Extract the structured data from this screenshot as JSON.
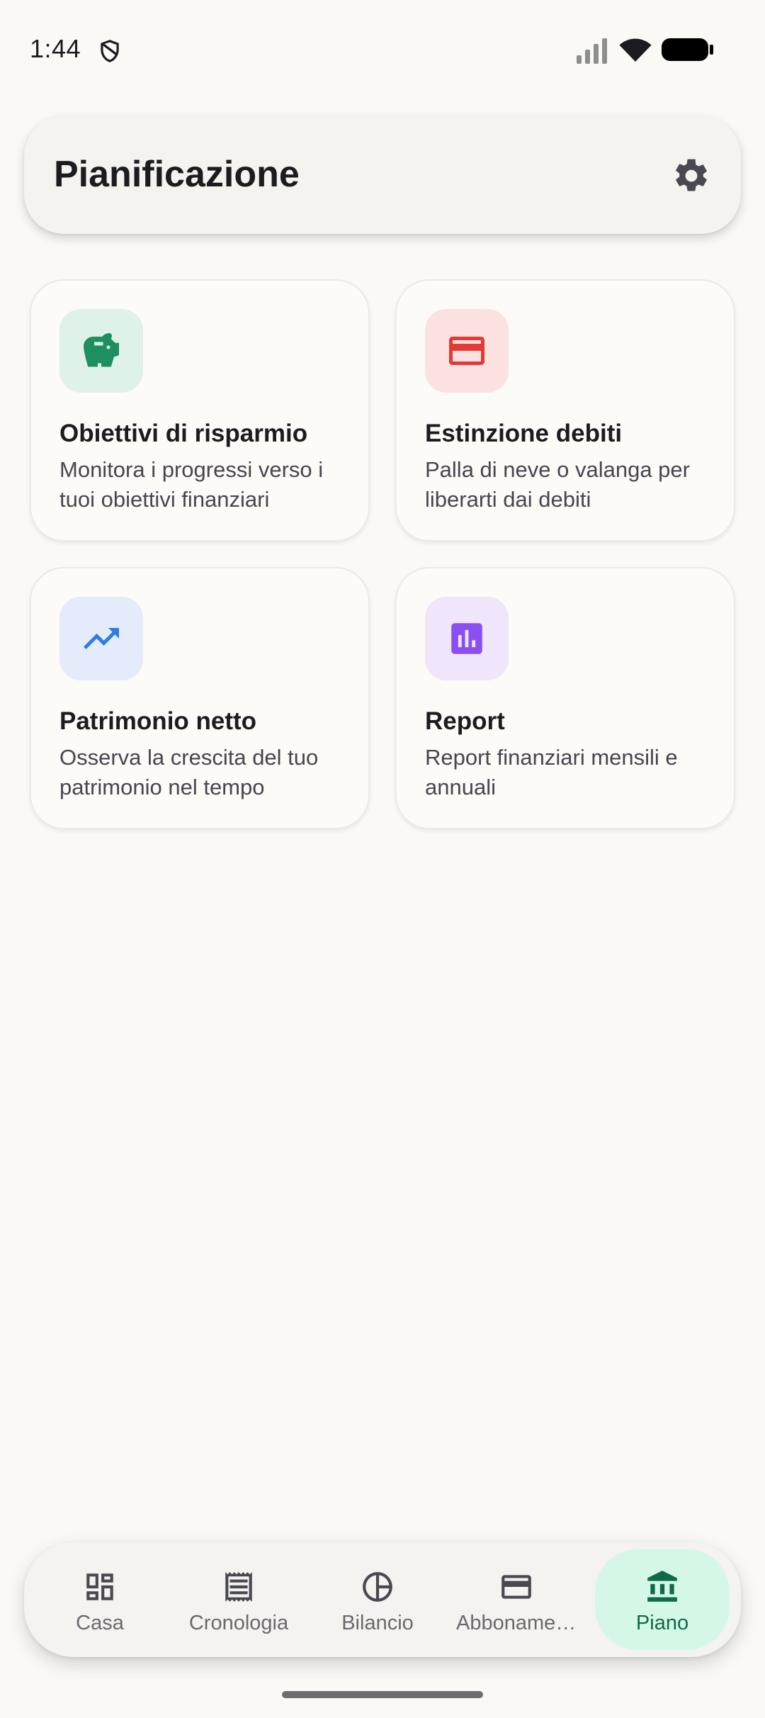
{
  "status_bar": {
    "time": "1:44",
    "icons": [
      "shield-icon",
      "signal-icon",
      "wifi-icon",
      "battery-icon"
    ]
  },
  "header": {
    "title": "Pianificazione",
    "settings_icon": "gear-icon"
  },
  "cards": [
    {
      "title": "Obiettivi di risparmio",
      "description": "Monitora i progressi verso i tuoi obiettivi finanziari",
      "icon": "piggy-bank-icon",
      "icon_color": "#1e8f5e",
      "icon_bg": "#dff2e7"
    },
    {
      "title": "Estinzione debiti",
      "description": "Palla di neve o valanga per liberarti dai debiti",
      "icon": "credit-card-icon",
      "icon_color": "#e53935",
      "icon_bg": "#fbe2e1"
    },
    {
      "title": "Patrimonio netto",
      "description": "Osserva la crescita del tuo patrimonio nel tempo",
      "icon": "trending-up-icon",
      "icon_color": "#2f7de1",
      "icon_bg": "#e4ecfb"
    },
    {
      "title": "Report",
      "description": "Report finanziari mensili e annuali",
      "icon": "bar-chart-icon",
      "icon_color": "#8b4ef0",
      "icon_bg": "#efe6fb"
    }
  ],
  "bottom_nav": {
    "items": [
      {
        "label": "Casa",
        "icon": "dashboard-icon",
        "active": false
      },
      {
        "label": "Cronologia",
        "icon": "receipt-icon",
        "active": false
      },
      {
        "label": "Bilancio",
        "icon": "pie-chart-icon",
        "active": false
      },
      {
        "label": "Abbonamenti",
        "icon": "credit-card-icon",
        "active": false
      },
      {
        "label": "Piano",
        "icon": "bank-icon",
        "active": true
      }
    ],
    "active_color": "#0d6b47",
    "active_bg": "#d5f8e6"
  }
}
